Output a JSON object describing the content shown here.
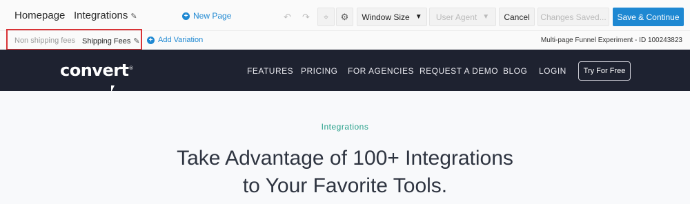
{
  "toolbar": {
    "page_name": "Homepage",
    "section_name": "Integrations",
    "new_page_label": "New Page",
    "window_size_label": "Window Size",
    "user_agent_label": "User Agent",
    "cancel_label": "Cancel",
    "status_label": "Changes Saved...",
    "save_label": "Save & Continue"
  },
  "variations": {
    "items": [
      {
        "label": "Non shipping fees"
      },
      {
        "label": "Shipping Fees"
      }
    ],
    "add_label": "Add Variation",
    "experiment_label": "Multi-page Funnel Experiment - ID 100243823"
  },
  "site": {
    "logo_text": "convert",
    "nav": [
      "FEATURES",
      "PRICING",
      "FOR AGENCIES",
      "REQUEST A DEMO",
      "BLOG",
      "LOGIN"
    ],
    "cta_label": "Try For Free",
    "eyebrow": "Integrations",
    "headline_line1": "Take Advantage of 100+ Integrations",
    "headline_line2": "to Your Favorite Tools."
  },
  "colors": {
    "accent": "#1e88d2",
    "nav_bg": "#1e2230",
    "highlight": "#d83236",
    "eyebrow": "#27a08a"
  }
}
